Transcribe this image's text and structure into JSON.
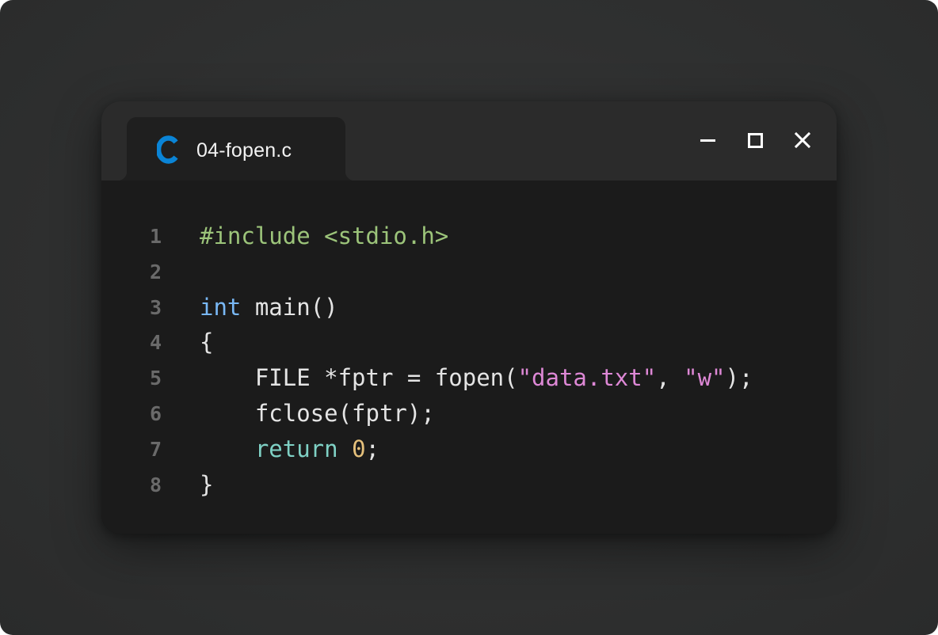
{
  "window": {
    "tab_title": "04-fopen.c",
    "tab_icon": "c-language-icon",
    "controls": {
      "minimize": "minimize-icon",
      "maximize": "maximize-icon",
      "close": "close-icon"
    },
    "colors": {
      "background": "#2e2f2f",
      "titlebar": "#2b2b2b",
      "editor": "#1b1b1b",
      "icon_accent": "#0a84d6"
    }
  },
  "code": {
    "lines": [
      {
        "number": "1",
        "tokens": [
          {
            "text": "#include <stdio.h>",
            "kind": "preprocessor"
          }
        ]
      },
      {
        "number": "2",
        "tokens": []
      },
      {
        "number": "3",
        "tokens": [
          {
            "text": "int",
            "kind": "keyword"
          },
          {
            "text": " main()",
            "kind": "plain"
          }
        ]
      },
      {
        "number": "4",
        "tokens": [
          {
            "text": "{",
            "kind": "plain"
          }
        ]
      },
      {
        "number": "5",
        "tokens": [
          {
            "text": "    FILE *fptr = fopen(",
            "kind": "plain"
          },
          {
            "text": "\"data.txt\"",
            "kind": "string"
          },
          {
            "text": ", ",
            "kind": "plain"
          },
          {
            "text": "\"w\"",
            "kind": "string"
          },
          {
            "text": ");",
            "kind": "plain"
          }
        ]
      },
      {
        "number": "6",
        "tokens": [
          {
            "text": "    fclose(fptr);",
            "kind": "plain"
          }
        ]
      },
      {
        "number": "7",
        "tokens": [
          {
            "text": "    ",
            "kind": "plain"
          },
          {
            "text": "return",
            "kind": "return"
          },
          {
            "text": " ",
            "kind": "plain"
          },
          {
            "text": "0",
            "kind": "number"
          },
          {
            "text": ";",
            "kind": "plain"
          }
        ]
      },
      {
        "number": "8",
        "tokens": [
          {
            "text": "}",
            "kind": "plain"
          }
        ]
      }
    ],
    "token_colors": {
      "preprocessor": "#9cc47a",
      "keyword": "#79b8f5",
      "return": "#7fd1c5",
      "string": "#de88d6",
      "number": "#e5c07b",
      "plain": "#e4e4e4",
      "line_number": "#6a6a6a"
    }
  }
}
